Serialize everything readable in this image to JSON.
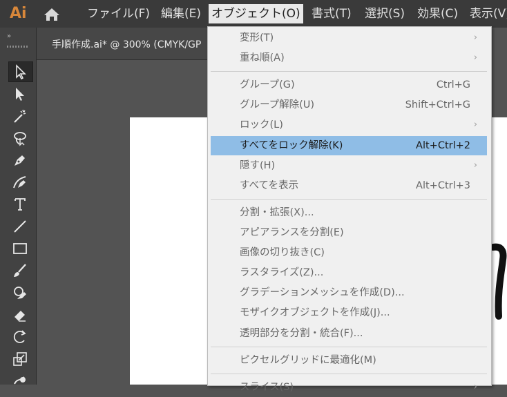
{
  "app": {
    "logo": "Ai"
  },
  "menubar": {
    "items": [
      {
        "label": "ファイル(F)"
      },
      {
        "label": "編集(E)"
      },
      {
        "label": "オブジェクト(O)"
      },
      {
        "label": "書式(T)"
      },
      {
        "label": "選択(S)"
      },
      {
        "label": "効果(C)"
      },
      {
        "label": "表示(V)"
      }
    ]
  },
  "toolbar": {
    "collapse": "»"
  },
  "document": {
    "tab_label": "手順作成.ai* @ 300% (CMYK/GP"
  },
  "object_menu": {
    "items": [
      {
        "label": "変形(T)",
        "shortcut": "",
        "submenu": true
      },
      {
        "label": "重ね順(A)",
        "shortcut": "",
        "submenu": true
      },
      {
        "label": "グループ(G)",
        "shortcut": "Ctrl+G",
        "submenu": false
      },
      {
        "label": "グループ解除(U)",
        "shortcut": "Shift+Ctrl+G",
        "submenu": false
      },
      {
        "label": "ロック(L)",
        "shortcut": "",
        "submenu": true
      },
      {
        "label": "すべてをロック解除(K)",
        "shortcut": "Alt+Ctrl+2",
        "submenu": false
      },
      {
        "label": "隠す(H)",
        "shortcut": "",
        "submenu": true
      },
      {
        "label": "すべてを表示",
        "shortcut": "Alt+Ctrl+3",
        "submenu": false
      },
      {
        "label": "分割・拡張(X)...",
        "shortcut": "",
        "submenu": false
      },
      {
        "label": "アピアランスを分割(E)",
        "shortcut": "",
        "submenu": false
      },
      {
        "label": "画像の切り抜き(C)",
        "shortcut": "",
        "submenu": false
      },
      {
        "label": "ラスタライズ(Z)...",
        "shortcut": "",
        "submenu": false
      },
      {
        "label": "グラデーションメッシュを作成(D)...",
        "shortcut": "",
        "submenu": false
      },
      {
        "label": "モザイクオブジェクトを作成(J)...",
        "shortcut": "",
        "submenu": false
      },
      {
        "label": "透明部分を分割・統合(F)...",
        "shortcut": "",
        "submenu": false
      },
      {
        "label": "ピクセルグリッドに最適化(M)",
        "shortcut": "",
        "submenu": false
      },
      {
        "label": "スライス(S)",
        "shortcut": "",
        "submenu": true
      }
    ],
    "chevron": "›"
  },
  "colors": {
    "accent": "#d8873a",
    "highlight": "#8fbde6"
  }
}
